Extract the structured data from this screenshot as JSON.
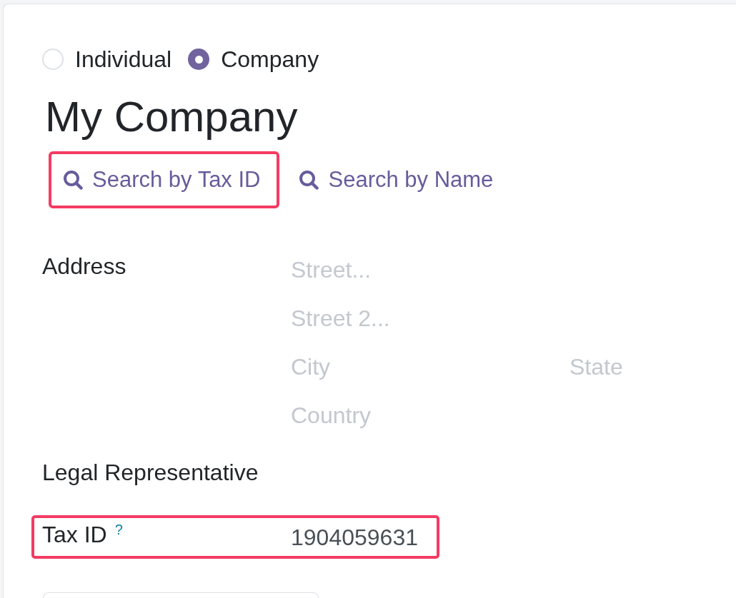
{
  "company_type": [
    {
      "label": "Individual",
      "selected": false
    },
    {
      "label": "Company",
      "selected": true
    }
  ],
  "name": "My Company",
  "search_buttons": [
    {
      "label": "Search by Tax ID",
      "highlighted": true
    },
    {
      "label": "Search by Name",
      "highlighted": false
    }
  ],
  "address": {
    "label": "Address",
    "rows": [
      {
        "fields": [
          {
            "placeholder": "Street..."
          }
        ]
      },
      {
        "fields": [
          {
            "placeholder": "Street 2..."
          }
        ]
      },
      {
        "fields": [
          {
            "placeholder": "City"
          },
          {
            "placeholder": "State"
          }
        ]
      },
      {
        "fields": [
          {
            "placeholder": "Country"
          }
        ]
      }
    ]
  },
  "legal_representative": {
    "label": "Legal Representative"
  },
  "tax_id": {
    "label": "Tax ID",
    "help": "?",
    "value": "1904059631",
    "highlighted": true
  }
}
